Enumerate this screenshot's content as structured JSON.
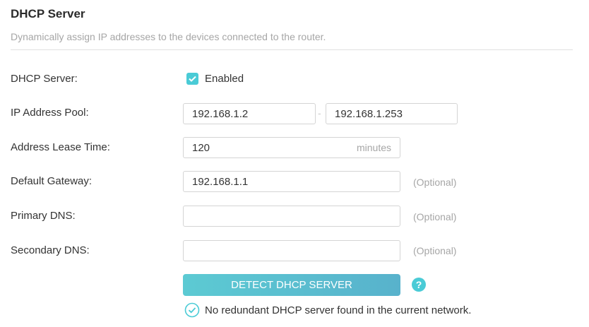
{
  "header": {
    "title": "DHCP Server",
    "description": "Dynamically assign IP addresses to the devices connected to the router."
  },
  "form": {
    "dhcp_server": {
      "label": "DHCP Server:",
      "checkbox_label": "Enabled",
      "checked": true
    },
    "ip_pool": {
      "label": "IP Address Pool:",
      "start": "192.168.1.2",
      "separator": "-",
      "end": "192.168.1.253"
    },
    "lease_time": {
      "label": "Address Lease Time:",
      "value": "120",
      "unit": "minutes"
    },
    "gateway": {
      "label": "Default Gateway:",
      "value": "192.168.1.1",
      "hint": "(Optional)"
    },
    "primary_dns": {
      "label": "Primary DNS:",
      "value": "",
      "hint": "(Optional)"
    },
    "secondary_dns": {
      "label": "Secondary DNS:",
      "value": "",
      "hint": "(Optional)"
    }
  },
  "actions": {
    "detect_label": "DETECT DHCP SERVER",
    "help_glyph": "?"
  },
  "status": {
    "message": "No redundant DHCP server found in the current network."
  },
  "colors": {
    "accent": "#4acbd6",
    "button_start": "#5ccad3",
    "button_end": "#58b2cc",
    "hint": "#a6a6a6"
  }
}
